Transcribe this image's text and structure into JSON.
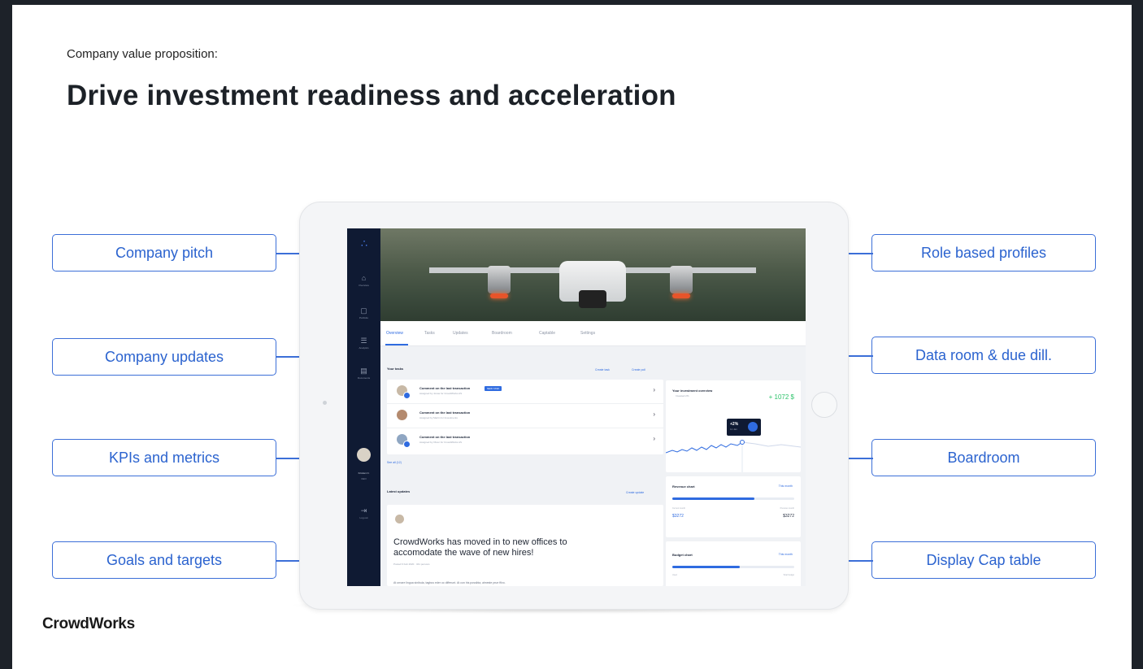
{
  "slide": {
    "subtitle": "Company value proposition:",
    "title": "Drive investment readiness and acceleration",
    "brand": "CrowdWorks"
  },
  "callouts": {
    "left": [
      "Company pitch",
      "Company updates",
      "KPIs and metrics",
      "Goals and targets"
    ],
    "right": [
      "Role based profiles",
      "Data room & due dill.",
      "Boardroom",
      "Display Cap table"
    ]
  },
  "colors": {
    "accent": "#2f6be0",
    "callout_border": "#3c6fd8",
    "sidebar": "#0f1a33",
    "positive": "#2ec36b"
  },
  "app": {
    "sidebar": {
      "logo_icon": "network-logo-icon",
      "items": [
        {
          "icon": "home-icon",
          "label": "Overview"
        },
        {
          "icon": "portfolio-icon",
          "label": "Portfolio"
        },
        {
          "icon": "chart-icon",
          "label": "Analytics"
        },
        {
          "icon": "document-icon",
          "label": "Documents"
        }
      ],
      "user_name": "Kristian N.",
      "user_role": "CEO",
      "logout_label": "Log out"
    },
    "tabs": [
      "Overview",
      "Tasks",
      "Updates",
      "Boardroom",
      "Captable",
      "Settings"
    ],
    "tasks": {
      "title": "Your tasks",
      "action_1": "Create task",
      "action_2": "Create poll",
      "see_all": "See all (12)",
      "rows": [
        {
          "title": "Comment on the last transaction",
          "sub": "Assigned by Jonas for CrowdWorks AS",
          "tag": "NEW TASK"
        },
        {
          "title": "Comment on the last transaction",
          "sub": "Assigned by Martin for Investments",
          "tag": ""
        },
        {
          "title": "Comment on the last transaction",
          "sub": "Assigned by Oliver for CrowdWorks AS",
          "tag": ""
        }
      ]
    },
    "updates": {
      "title": "Latest updates",
      "action": "Create update",
      "headline": "CrowdWorks has moved in to new offices to accomodate the wave of new hires!",
      "meta": "Posted 6 Feb 2020 · 341 persons",
      "body": "At ornare lingua sinibula, tagbus eder oc differunt. At con his possibia, almeste prue ffivo."
    },
    "investment": {
      "title": "Your investment overview",
      "sub": "Invested 2%",
      "value": "+ 1072 $",
      "tooltip_value": "+2%",
      "tooltip_sub": "11 Jan"
    },
    "revenue": {
      "title": "Revenue chart",
      "select": "This month",
      "fill_fraction": 0.67,
      "left_label": "Current month",
      "right_label": "Previous month",
      "left_value": "$3272",
      "right_value": "$3272"
    },
    "budget": {
      "title": "Budget chart",
      "select": "This month",
      "fill_fraction": 0.55,
      "left_label": "Used",
      "right_label": "Total budget"
    }
  }
}
